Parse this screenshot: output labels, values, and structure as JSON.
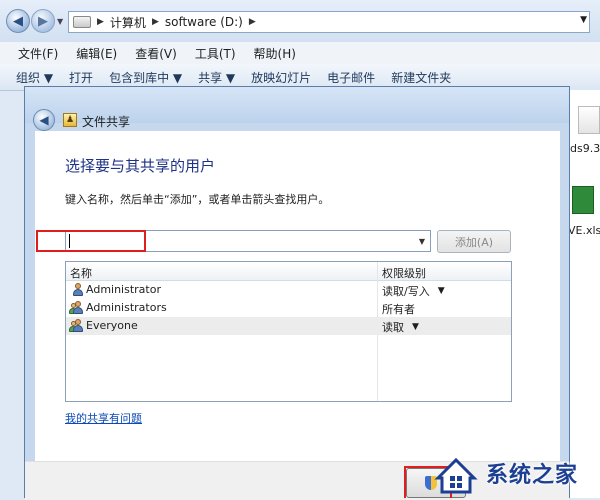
{
  "explorer": {
    "path": [
      "计算机",
      "software (D:)"
    ],
    "menu": [
      "文件(F)",
      "编辑(E)",
      "查看(V)",
      "工具(T)",
      "帮助(H)"
    ],
    "toolbar": [
      "组织 ▼",
      "打开",
      "包含到库中 ▼",
      "共享 ▼",
      "放映幻灯片",
      "电子邮件",
      "新建文件夹"
    ],
    "files": [
      "ds9.3",
      "VE.xlsx"
    ]
  },
  "dialog": {
    "title": "文件共享",
    "heading": "选择要与其共享的用户",
    "description": "键入名称，然后单击“添加”，或者单击箭头查找用户。",
    "input_value": "",
    "add_button": "添加(A)",
    "columns": {
      "name": "名称",
      "permission": "权限级别"
    },
    "rows": [
      {
        "name": "Administrator",
        "permission": "读取/写入",
        "dropdown": true,
        "icon": "user-icon"
      },
      {
        "name": "Administrators",
        "permission": "所有者",
        "dropdown": false,
        "icon": "group-icon"
      },
      {
        "name": "Everyone",
        "permission": "读取",
        "dropdown": true,
        "icon": "group-icon",
        "selected": true
      }
    ],
    "help_link": "我的共享有问题"
  },
  "watermark": {
    "text": "系统之家"
  },
  "colors": {
    "heading": "#1e3287",
    "link": "#0b49b7",
    "highlight": "#e01e1e"
  }
}
